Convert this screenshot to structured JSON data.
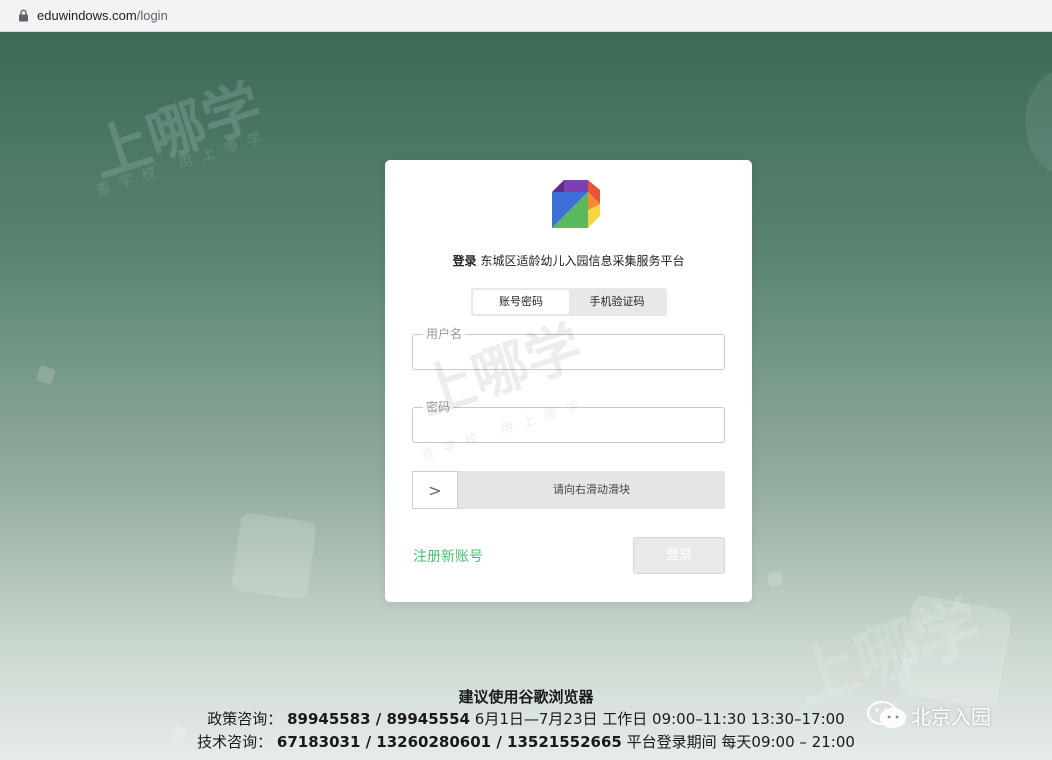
{
  "browser": {
    "url_domain": "eduwindows.com",
    "url_path": "/login"
  },
  "watermark": {
    "brand": "上哪学",
    "slogan": "查学校 用上哪学"
  },
  "login": {
    "login_word": "登录",
    "platform_name": "东城区适龄幼儿入园信息采集服务平台",
    "tabs": [
      {
        "label": "账号密码",
        "active": true
      },
      {
        "label": "手机验证码",
        "active": false
      }
    ],
    "username": {
      "label": "用户名",
      "value": ""
    },
    "password": {
      "label": "密码",
      "value": ""
    },
    "slider": {
      "handle": ">",
      "text": "请向右滑动滑块"
    },
    "register_link": "注册新账号",
    "login_button": "登录"
  },
  "footer": {
    "browser_tip": "建议使用谷歌浏览器",
    "policy_label": "政策咨询：",
    "policy_phones": "89945583 / 89945554",
    "policy_time": "6月1日—7月23日 工作日 09:00–11:30 13:30–17:00",
    "tech_label": "技术咨询：",
    "tech_phones": "67183031 / 13260280601 / 13521552665",
    "tech_time": "平台登录期间 每天09:00 – 21:00"
  },
  "overlay": {
    "wechat_account": "北京入园"
  },
  "colors": {
    "accent_green": "#4cbf6e",
    "bg_dark": "#3b6a57"
  }
}
